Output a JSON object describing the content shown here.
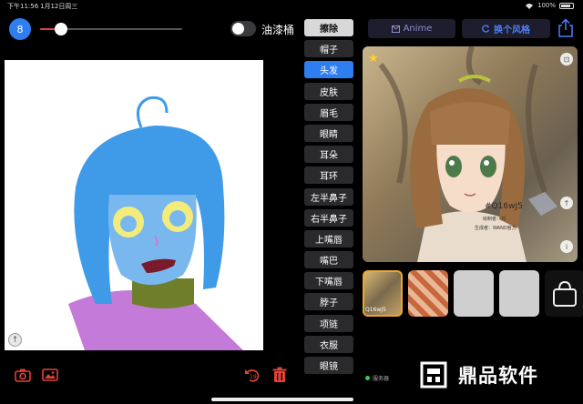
{
  "status_bar": {
    "time": "下午11:56",
    "date": "1月12日周三",
    "battery": "100%"
  },
  "toolbar": {
    "brush_size": "8",
    "brush_slider_value": 0.15,
    "paint_bucket_label": "油漆桶",
    "paint_bucket_on": false
  },
  "parts": {
    "items": [
      "擦除",
      "帽子",
      "头发",
      "皮肤",
      "眉毛",
      "眼睛",
      "耳朵",
      "耳环",
      "左半鼻子",
      "右半鼻子",
      "上嘴唇",
      "嘴巴",
      "下嘴唇",
      "脖子",
      "项链",
      "衣服",
      "眼镜"
    ],
    "active": "头发"
  },
  "result": {
    "anime_label": "Anime",
    "style_label": "换个风格",
    "watermark_code": "#Q16wJ5",
    "watermark_line1": "绘制者：刘",
    "watermark_line2": "生成者：WAND官方"
  },
  "thumbnails": {
    "selected_code": "Q16wJ5"
  },
  "footer": {
    "server_label": "服务器",
    "brand_name": "鼎品软件"
  },
  "colors": {
    "accent_blue": "#2f7ef0",
    "accent_red": "#e0423a",
    "selected_border": "#e8a72e"
  }
}
